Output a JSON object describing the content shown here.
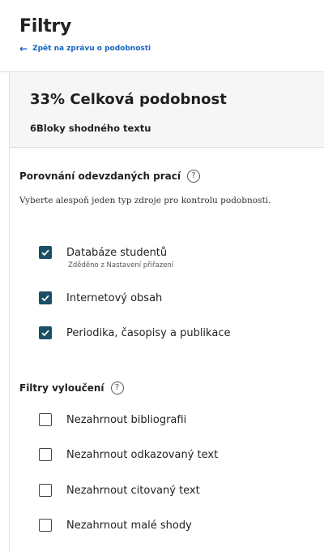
{
  "header": {
    "title": "Filtry",
    "back_label": "Zpět na zprávu o podobnosti"
  },
  "summary": {
    "similarity": "33% Celková podobnost",
    "blocks": "6Bloky shodného textu"
  },
  "comparison": {
    "heading": "Porovnání odevzdaných prací",
    "instructions": "Vyberte alespoň jeden typ zdroje pro kontrolu podobnosti.",
    "options": [
      {
        "label": "Databáze studentů",
        "sublabel": "Zděděno z Nastavení přiřazení",
        "checked": true
      },
      {
        "label": "Internetový obsah",
        "checked": true
      },
      {
        "label": "Periodika, časopisy a publikace",
        "checked": true
      }
    ]
  },
  "exclusions": {
    "heading": "Filtry vyloučení",
    "options": [
      {
        "label": "Nezahrnout bibliografii",
        "checked": false
      },
      {
        "label": "Nezahrnout odkazovaný text",
        "checked": false
      },
      {
        "label": "Nezahrnout citovaný text",
        "checked": false
      },
      {
        "label": "Nezahrnout malé shody",
        "checked": false
      }
    ]
  },
  "colors": {
    "accent": "#1565c0",
    "checkbox_checked": "#1b4f66",
    "summary_bg": "#f6f6f6"
  }
}
